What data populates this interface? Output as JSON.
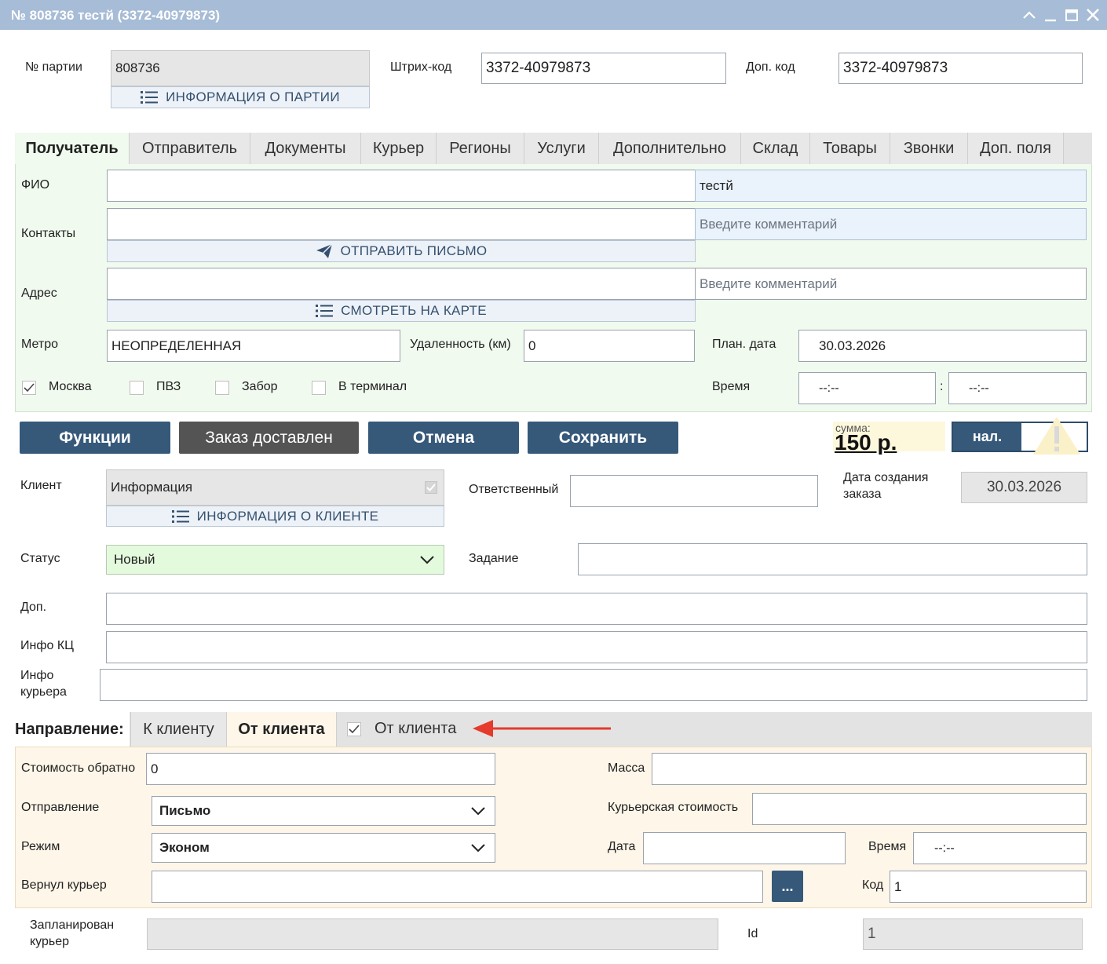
{
  "window": {
    "title": "№ 808736 тестй (3372-40979873)"
  },
  "header": {
    "party_label": "№ партии",
    "party_value": "808736",
    "party_info_link": "ИНФОРМАЦИЯ О ПАРТИИ",
    "barcode_label": "Штрих-код",
    "barcode_value": "3372-40979873",
    "extra_code_label": "Доп. код",
    "extra_code_value": "3372-40979873"
  },
  "tabs": [
    {
      "label": "Получатель",
      "active": true
    },
    {
      "label": "Отправитель"
    },
    {
      "label": "Документы"
    },
    {
      "label": "Курьер"
    },
    {
      "label": "Регионы"
    },
    {
      "label": "Услуги"
    },
    {
      "label": "Дополнительно"
    },
    {
      "label": "Склад"
    },
    {
      "label": "Товары"
    },
    {
      "label": "Звонки"
    },
    {
      "label": "Доп. поля"
    }
  ],
  "recipient": {
    "fio_label": "ФИО",
    "fio_value": "",
    "fio_extra": "тестй",
    "contacts_label": "Контакты",
    "contacts_value": "",
    "contacts_comment_placeholder": "Введите комментарий",
    "send_letter": "ОТПРАВИТЬ ПИСЬМО",
    "address_label": "Адрес",
    "address_value": "",
    "address_comment_placeholder": "Введите  комментарий",
    "view_map": "СМОТРЕТЬ НА КАРТЕ",
    "metro_label": "Метро",
    "metro_value": "НЕОПРЕДЕЛЕННАЯ",
    "distance_label": "Удаленность (км)",
    "distance_value": "0",
    "plan_date_label": "План. дата",
    "plan_date_value": "30.03.2026",
    "time_label": "Время",
    "time_from": "--:--",
    "time_sep": ":",
    "time_to": "--:--",
    "checks": [
      {
        "label": "Москва",
        "checked": true
      },
      {
        "label": "ПВЗ",
        "checked": false
      },
      {
        "label": "Забор",
        "checked": false
      },
      {
        "label": "В терминал",
        "checked": false
      }
    ]
  },
  "actions": {
    "functions": "Функции",
    "delivered": "Заказ доставлен",
    "cancel": "Отмена",
    "save": "Сохранить",
    "sum_label": "сумма:",
    "sum_value": "150 р.",
    "payment": "нал."
  },
  "client": {
    "label": "Клиент",
    "value": "Информация",
    "info_link": "ИНФОРМАЦИЯ О КЛИЕНТЕ",
    "responsible_label": "Ответственный",
    "responsible_value": "",
    "created_label_1": "Дата создания",
    "created_label_2": "заказа",
    "created_value": "30.03.2026",
    "status_label": "Статус",
    "status_value": "Новый",
    "task_label": "Задание",
    "task_value": "",
    "extra_label": "Доп.",
    "extra_value": "",
    "kc_label": "Инфо КЦ",
    "kc_value": "",
    "courier_info_label_1": "Инфо",
    "courier_info_label_2": "курьера",
    "courier_info_value": ""
  },
  "direction": {
    "label": "Направление:",
    "tab_to": "К клиенту",
    "tab_from": "От клиента",
    "check_label": "От клиента",
    "check_checked": true,
    "return_cost_label": "Стоимость обратно",
    "return_cost_value": "0",
    "mass_label": "Масса",
    "mass_value": "",
    "shipment_label": "Отправление",
    "shipment_value": "Письмо",
    "courier_cost_label": "Курьерская стоимость",
    "courier_cost_value": "",
    "mode_label": "Режим",
    "mode_value": "Эконом",
    "date_label": "Дата",
    "date_value": "",
    "time_label": "Время",
    "time_value": "--:--",
    "returned_courier_label": "Вернул курьер",
    "returned_courier_value": "",
    "more_button": "...",
    "code_label": "Код",
    "code_value": "1"
  },
  "footer": {
    "planned_label_1": "Запланирован",
    "planned_label_2": "курьер",
    "planned_value": "",
    "id_label": "Id",
    "id_value": "1"
  },
  "colors": {
    "titlebar": "#a7bcd6",
    "primary_button": "#36597a",
    "recipient_panel": "#f0faee",
    "direction_panel": "#fdf6e9",
    "arrow": "#e53a2c"
  }
}
